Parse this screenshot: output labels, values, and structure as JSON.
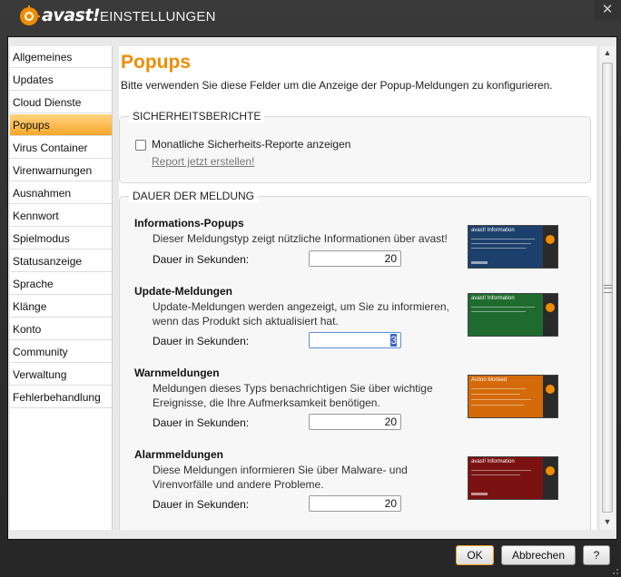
{
  "window": {
    "brand": "avast!",
    "title": "EINSTELLUNGEN",
    "close_glyph": "✕"
  },
  "sidebar": {
    "items": [
      {
        "label": "Allgemeines"
      },
      {
        "label": "Updates"
      },
      {
        "label": "Cloud Dienste"
      },
      {
        "label": "Popups",
        "active": true
      },
      {
        "label": "Virus Container"
      },
      {
        "label": "Virenwarnungen"
      },
      {
        "label": "Ausnahmen"
      },
      {
        "label": "Kennwort"
      },
      {
        "label": "Spielmodus"
      },
      {
        "label": "Statusanzeige"
      },
      {
        "label": "Sprache"
      },
      {
        "label": "Klänge"
      },
      {
        "label": "Konto"
      },
      {
        "label": "Community"
      },
      {
        "label": "Verwaltung"
      },
      {
        "label": "Fehlerbehandlung"
      }
    ]
  },
  "main": {
    "title": "Popups",
    "description": "Bitte verwenden Sie diese Felder um die Anzeige der Popup-Meldungen zu konfigurieren.",
    "security_reports": {
      "heading": "SICHERHEITSBERICHTE",
      "checkbox_label": "Monatliche Sicherheits-Reporte anzeigen",
      "checked": false,
      "link": "Report jetzt erstellen!"
    },
    "duration": {
      "heading": "DAUER DER MELDUNG",
      "sections": [
        {
          "title": "Informations-Popups",
          "text": "Dieser Meldungstyp zeigt nützliche Informationen über avast!",
          "duration_label": "Dauer in Sekunden:",
          "value": "20",
          "thumb_title": "avast! Information",
          "thumb_color": "#1d3f6b"
        },
        {
          "title": "Update-Meldungen",
          "text": "Update-Meldungen werden angezeigt, um Sie zu informieren, wenn das Produkt sich aktualisiert hat.",
          "duration_label": "Dauer in Sekunden:",
          "value": "3",
          "thumb_title": "avast! Information",
          "thumb_color": "#1f6b2f"
        },
        {
          "title": "Warnmeldungen",
          "text": "Meldungen dieses Typs benachrichtigen Sie über wichtige Ereignisse, die Ihre Aufmerksamkeit benötigen.",
          "duration_label": "Dauer in Sekunden:",
          "value": "20",
          "thumb_title": "Action blocked",
          "thumb_color": "#d46a0a"
        },
        {
          "title": "Alarmmeldungen",
          "text": "Diese Meldungen informieren Sie über Malware- und Virenvorfälle und andere Probleme.",
          "duration_label": "Dauer in Sekunden:",
          "value": "20",
          "thumb_title": "avast! Information",
          "thumb_color": "#7a1212"
        }
      ]
    }
  },
  "footer": {
    "ok_label": "OK",
    "cancel_label": "Abbrechen",
    "help_label": "?"
  },
  "colors": {
    "accent": "#f08c00",
    "active_nav": "#f7a72a"
  }
}
